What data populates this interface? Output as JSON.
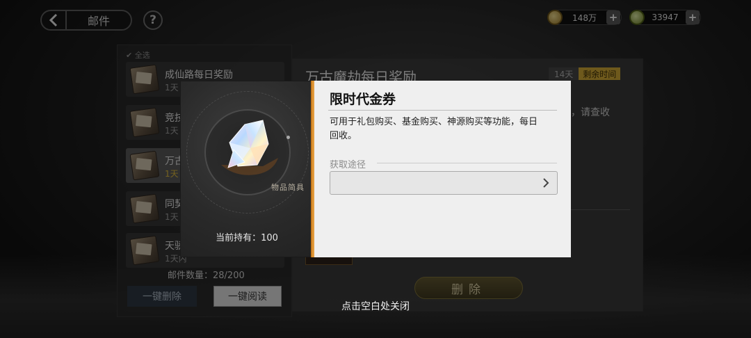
{
  "header": {
    "back_label": "邮件",
    "help_label": "?"
  },
  "currencies": [
    {
      "icon": "copper-coin-icon",
      "amount": "148万",
      "color": "#c9a74a"
    },
    {
      "icon": "gem-icon",
      "amount": "33947",
      "color": "#9aae3a"
    }
  ],
  "mail_list": {
    "filter_label": "✔ 全选",
    "items": [
      {
        "title": "成仙路每日奖励",
        "days": "1天"
      },
      {
        "title": "竞技",
        "days": "1天"
      },
      {
        "title": "万古",
        "days": "1天"
      },
      {
        "title": "同契",
        "days": "1天"
      },
      {
        "title": "天骄",
        "days": "1天内"
      }
    ],
    "count_label": "邮件数量：28/200",
    "delete_all_label": "一键删除",
    "read_all_label": "一键阅读"
  },
  "detail": {
    "title": "万古魔劫每日奖励",
    "days_tag": "14天",
    "remaining_tag": "剩余时间",
    "body_fragment": "，请查收",
    "delete_label": "删除"
  },
  "item_popup": {
    "tag": "物品简具",
    "held_label": "当前持有：",
    "held_value": "100",
    "name": "限时代金券",
    "description": "可用于礼包购买、基金购买、神源购买等功能，每日回收。",
    "source_label": "获取途径"
  },
  "close_hint": "点击空白处关闭",
  "colors": {
    "accent_orange": "#e29a3a",
    "gold": "#c9a233"
  }
}
